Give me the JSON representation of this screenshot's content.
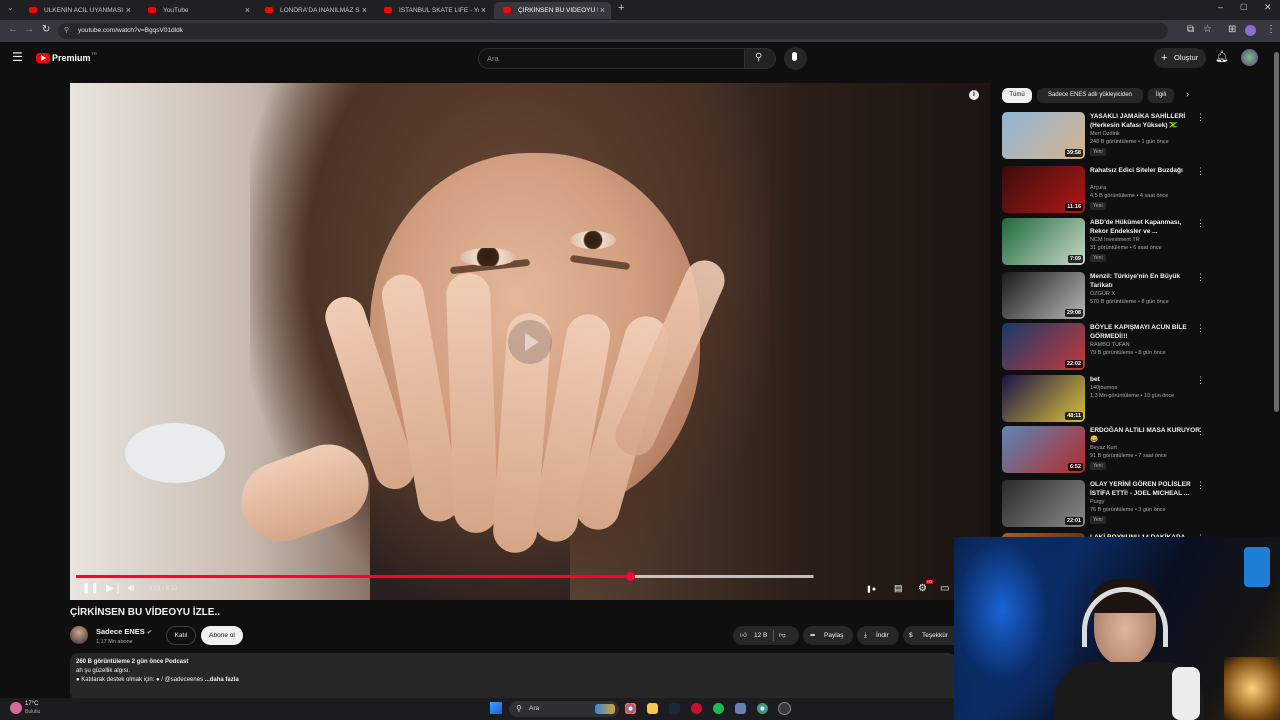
{
  "browser": {
    "tabs": [
      {
        "label": "ÜLKENİN ACİL UYANMASI GER...",
        "active": false
      },
      {
        "label": "YouTube",
        "active": false
      },
      {
        "label": "LONDRA'DA İNANILMAZ SOKAK...",
        "active": false
      },
      {
        "label": "ISTANBUL SKATE LIFE - YouTube",
        "active": false
      },
      {
        "label": "ÇİRKİNSEN BU VİDEOYU İZLE...",
        "active": true
      }
    ],
    "url": "youtube.com/watch?v=BgqsV01dldk"
  },
  "header": {
    "logo": "Premium",
    "logo_sup": "TR",
    "search_placeholder": "Ara",
    "create_label": "Oluştur"
  },
  "player": {
    "time": "6:01 / 8:02",
    "progress": 0.75,
    "buffered": 0.998,
    "hd_badge": "HD"
  },
  "video": {
    "title": "ÇİRKİNSEN BU VİDEOYU İZLE..",
    "channel": "Sadece ENES",
    "subscribers": "1,17 Mn abone",
    "join_label": "Katıl",
    "subscribe_label": "Abone ol",
    "likes": "12 B",
    "share_label": "Paylaş",
    "download_label": "İndir",
    "thanks_label": "Teşekkür",
    "views_line": "260 B görüntüleme  2 gün önce  Podcast",
    "desc_line1": "ah şu güzellik algısı.",
    "desc_line2": "● Katılarak destek olmak için:  ● / @sadeceenes",
    "more_label": "...daha fazla"
  },
  "chips": [
    "Tümü",
    "Sadece ENES adlı yükleyiciden",
    "İlgili"
  ],
  "recommendations": [
    {
      "title": "YASAKLI JAMAİKA SAHİLLERİ (Herkesin Kafası Yüksek) 🇯🇲",
      "channel": "Mert Özdirik",
      "meta": "248 B görüntüleme • 1 gün önce",
      "badge": "Yeni",
      "duration": "39:58",
      "colors": [
        "#8fb6d6",
        "#d8b28c"
      ]
    },
    {
      "title": "Rahatsız Edici Siteler Buzdağı",
      "channel": "Arçura",
      "meta": "4,5 B görüntüleme • 4 saat önce",
      "badge": "Yeni",
      "duration": "11:16",
      "colors": [
        "#3a0c0c",
        "#b01818"
      ]
    },
    {
      "title": "ABD'de Hükümet Kapanması, Rekor Endeksler ve ...",
      "channel": "NCM Investment TR",
      "meta": "31 görüntüleme • 6 saat önce",
      "badge": "Yeni",
      "duration": "7:09",
      "colors": [
        "#1d6a3a",
        "#c9d9c9"
      ]
    },
    {
      "title": "Menzil: Türkiye'nin En Büyük Tarikatı",
      "channel": "ÖZGÜR X",
      "meta": "570 B görüntüleme • 8 gün önce",
      "badge": "",
      "duration": "29:08",
      "colors": [
        "#1a1a1a",
        "#b8b8b8"
      ]
    },
    {
      "title": "BÖYLE KAPIŞMAYI ACUN BİLE GÖRMEDİ!!!",
      "channel": "RAMBO TUFAN",
      "meta": "79 B görüntüleme • 8 gün önce",
      "badge": "",
      "duration": "22:02",
      "colors": [
        "#173a6b",
        "#c43a3a"
      ]
    },
    {
      "title": "bet",
      "channel": "140journos",
      "meta": "1,3 Mn görüntüleme • 10 gün önce",
      "badge": "",
      "duration": "48:11",
      "colors": [
        "#1b1448",
        "#d9c13a"
      ]
    },
    {
      "title": "ERDOĞAN ALTILI MASA KURUYOR 😂",
      "channel": "Beyaz Kurt",
      "meta": "91 B görüntüleme • 7 saat önce",
      "badge": "Yeni",
      "duration": "6:52",
      "colors": [
        "#5a86b8",
        "#b52a2a"
      ]
    },
    {
      "title": "OLAY YERİNİ GÖREN POLİSLER İSTİFA ETTİ! - JOEL MICHEAL ...",
      "channel": "Purgy",
      "meta": "76 B görüntüleme • 3 gün önce",
      "badge": "Yeni",
      "duration": "22:01",
      "colors": [
        "#2a2a2a",
        "#8a8a8a"
      ]
    },
    {
      "title": "LAKİ BOYNUNU 14 DAKİKADA",
      "channel": "",
      "meta": "",
      "badge": "",
      "duration": "",
      "colors": [
        "#b55a1a",
        "#2a2a2a"
      ]
    }
  ],
  "taskbar": {
    "weather_temp": "17°C",
    "weather_label": "Bulutlu",
    "search_label": "Ara"
  }
}
